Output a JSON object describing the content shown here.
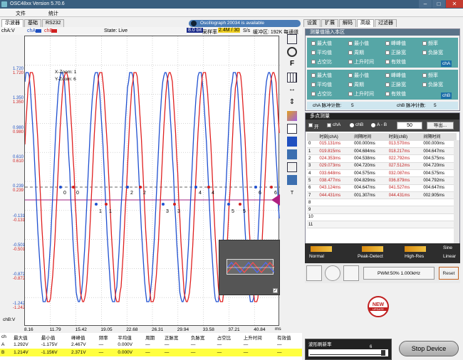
{
  "title": "OSC48xx  Version 5.70.6",
  "menu": {
    "file": "文件",
    "stats": "统计"
  },
  "left_tabs": [
    "示波器",
    "基础",
    "RS232"
  ],
  "scope": {
    "chA_label": "chA",
    "chB_label": "chB",
    "state": "State: Live",
    "bits": "8.0 bit",
    "sample_label": "采样率",
    "sample_value": "2.4M / 30",
    "sample_unit": "S/s",
    "buffer": "缓冲区: 192K 每通道",
    "x_zoom": "X-Zoom: 1",
    "y_zoom": "Y-Zoom: 6",
    "y_axis_label": "chA:V",
    "x_axis_label": "chB:V",
    "x_unit": "ms",
    "update_banner": "Oscillograph  20034 is available",
    "new_badge": "NEW",
    "update_badge": "UPDATE"
  },
  "y_ticks": [
    {
      "blue": "1.720",
      "red": "1.720"
    },
    {
      "blue": "1.350",
      "red": "1.350"
    },
    {
      "blue": "0.980",
      "red": "0.980"
    },
    {
      "blue": "0.610",
      "red": "0.610"
    },
    {
      "blue": "0.239",
      "red": "0.239"
    },
    {
      "blue": "-0.131",
      "red": "-0.131"
    },
    {
      "blue": "-0.501",
      "red": "-0.501"
    },
    {
      "blue": "-0.872",
      "red": "-0.872"
    },
    {
      "blue": "-1.242",
      "red": "-1.242"
    }
  ],
  "x_ticks": [
    "8.16",
    "11.79",
    "15.42",
    "19.05",
    "22.68",
    "26.31",
    "29.94",
    "33.58",
    "37.21",
    "40.84"
  ],
  "markers_top": [
    "0",
    "0",
    "2",
    "2",
    "4",
    "4",
    "6",
    "6"
  ],
  "markers_bottom": [
    "1",
    "1",
    "3",
    "3",
    "5",
    "5"
  ],
  "stats": {
    "headers": [
      "ch",
      "最大值",
      "最小值",
      "峰峰值",
      "频率",
      "平均值",
      "周期",
      "正脉宽",
      "负脉宽",
      "占空比",
      "上升时间",
      "有效值"
    ],
    "rows": [
      [
        "A",
        "1.292V",
        "-1.175V",
        "2.467V",
        "—",
        "0.000V",
        "—",
        "—",
        "—",
        "—",
        "—",
        "—"
      ],
      [
        "B",
        "1.214V",
        "-1.156V",
        "2.371V",
        "—",
        "0.000V",
        "—",
        "—",
        "—",
        "—",
        "—",
        "—"
      ]
    ]
  },
  "right_tabs": [
    "设置",
    "扩展",
    "解码",
    "高级",
    "过滤器"
  ],
  "measure": {
    "header": "测量值插入本区",
    "group_a": [
      "最大值",
      "最小值",
      "峰峰值",
      "频率",
      "平均值",
      "周期",
      "正脉宽",
      "负脉宽",
      "占空比",
      "上升时间",
      "有效值"
    ],
    "group_b": [
      "最大值",
      "最小值",
      "峰峰值",
      "频率",
      "平均值",
      "周期",
      "正脉宽",
      "负脉宽",
      "占空比",
      "上升时间",
      "有效值"
    ],
    "chA_tag": "chA",
    "chB_tag": "chB",
    "chA_count_label": "chA 脉冲计数:",
    "chA_count": "5",
    "chB_count_label": "chB 脉冲计数:",
    "chB_count": "5"
  },
  "multipoint": {
    "header": "多点测量",
    "open_label": "开",
    "chA_opt": "chA",
    "chB_opt": "chB",
    "ab_opt": "A - B",
    "count": "50",
    "export": "导出...",
    "columns": [
      "",
      "时刻(chA)",
      "间隔时间",
      "时刻(chB)",
      "间隔时间"
    ],
    "rows": [
      [
        "0",
        "015.131ms",
        "000.000ms",
        "013.570ms",
        "000.000ms"
      ],
      [
        "1",
        "019.815ms",
        "004.684ms",
        "018.217ms",
        "004.647ms"
      ],
      [
        "2",
        "024.353ms",
        "004.538ms",
        "022.792ms",
        "004.575ms"
      ],
      [
        "3",
        "029.073ms",
        "004.720ms",
        "027.512ms",
        "004.720ms"
      ],
      [
        "4",
        "033.648ms",
        "004.575ms",
        "032.087ms",
        "004.575ms"
      ],
      [
        "5",
        "038.477ms",
        "004.829ms",
        "036.879ms",
        "004.792ms"
      ],
      [
        "6",
        "043.124ms",
        "004.647ms",
        "041.527ms",
        "004.647ms"
      ],
      [
        "7",
        "044.431ms",
        "001.307ms",
        "044.431ms",
        "002.905ms"
      ],
      [
        "8",
        "",
        "",
        "",
        ""
      ],
      [
        "9",
        "",
        "",
        "",
        ""
      ],
      [
        "10",
        "",
        "",
        "",
        ""
      ],
      [
        "11",
        "",
        "",
        "",
        ""
      ]
    ]
  },
  "acq": {
    "normal": "Normal",
    "peak": "Peak-Detect",
    "hires": "High-Res",
    "sine": "Sine",
    "linear": "Linear",
    "pwm": "PWM:50% 1.000kHz",
    "reset": "Reset"
  },
  "refresh": {
    "label": "波形刷新率",
    "value": "6"
  },
  "stop_button": "Stop Device"
}
